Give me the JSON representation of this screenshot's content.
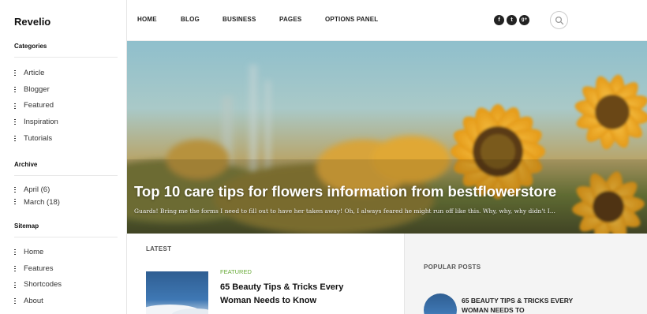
{
  "site": {
    "logo": "Revelio"
  },
  "sidebar": {
    "categories": {
      "title": "Categories",
      "items": [
        "Article",
        "Blogger",
        "Featured",
        "Inspiration",
        "Tutorials"
      ]
    },
    "archive": {
      "title": "Archive",
      "items": [
        "April (6)",
        "March (18)"
      ]
    },
    "sitemap": {
      "title": "Sitemap",
      "items": [
        "Home",
        "Features",
        "Shortcodes",
        "About"
      ]
    }
  },
  "nav": {
    "items": [
      "HOME",
      "BLOG",
      "BUSINESS",
      "PAGES",
      "OPTIONS PANEL"
    ],
    "social": [
      {
        "icon": "facebook-icon",
        "glyph": "f"
      },
      {
        "icon": "twitter-icon",
        "glyph": "t"
      },
      {
        "icon": "google-plus-icon",
        "glyph": "g+"
      }
    ],
    "search_icon": "search-icon"
  },
  "hero": {
    "title": "Top 10 care tips for flowers information from bestflowerstore",
    "excerpt": "Guards! Bring me the forms I need to fill out to have her taken away! Oh, I always feared he might run off like this. Why, why, why didn't I..."
  },
  "latest": {
    "label": "LATEST",
    "post": {
      "category": "FEATURED",
      "title": "65 Beauty Tips & Tricks Every Woman Needs to Know"
    }
  },
  "popular": {
    "label": "POPULAR POSTS",
    "post": {
      "title": "65 BEAUTY TIPS & TRICKS EVERY WOMAN NEEDS TO"
    }
  },
  "colors": {
    "accent_green": "#6aab3a",
    "sidebar_border": "#e6e6e6"
  }
}
